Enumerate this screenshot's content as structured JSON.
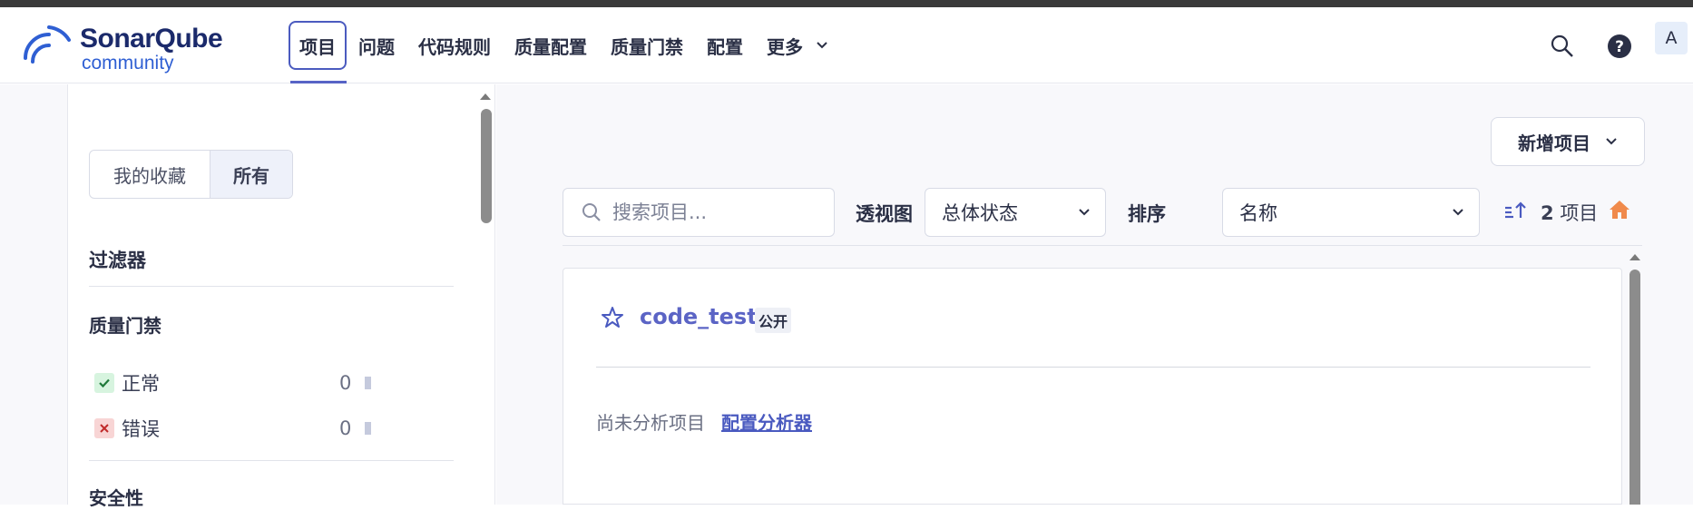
{
  "app": {
    "brand": "SonarQube",
    "edition": "community"
  },
  "nav": {
    "items": [
      {
        "label": "项目"
      },
      {
        "label": "问题"
      },
      {
        "label": "代码规则"
      },
      {
        "label": "质量配置"
      },
      {
        "label": "质量门禁"
      },
      {
        "label": "配置"
      },
      {
        "label": "更多"
      }
    ],
    "active_index": 0,
    "icons": [
      "search-icon",
      "help-icon"
    ],
    "avatar": "A"
  },
  "sidebar": {
    "toggle": {
      "favorites": "我的收藏",
      "all": "所有",
      "selected": "all"
    },
    "filters_title": "过滤器",
    "quality_gate": {
      "title": "质量门禁",
      "rows": [
        {
          "label": "正常",
          "count": "0",
          "status": "ok"
        },
        {
          "label": "错误",
          "count": "0",
          "status": "error"
        }
      ]
    },
    "security_title": "安全性"
  },
  "toolbar": {
    "new_project": "新增项目",
    "search_placeholder": "搜索项目...",
    "perspective_label": "透视图",
    "perspective_value": "总体状态",
    "sort_label": "排序",
    "sort_value": "名称",
    "project_count": "2",
    "project_count_suffix": "项目"
  },
  "projects": [
    {
      "name": "code_test",
      "visibility": "公开",
      "status_text": "尚未分析项目",
      "action_link": "配置分析器"
    }
  ],
  "colors": {
    "accent": "#5b64c5",
    "ok_badge": "#d7f4df",
    "error_badge": "#f8d5d5",
    "home_icon": "#f08a4b"
  }
}
